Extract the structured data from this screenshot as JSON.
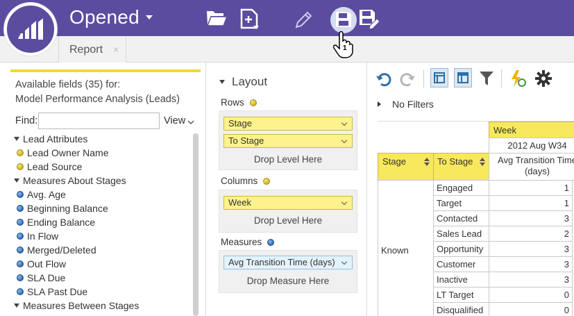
{
  "header": {
    "title": "Opened",
    "badge_count": "1",
    "colors": {
      "bar": "#5c4c9f",
      "accent_yellow": "#f3d730"
    },
    "icons": [
      "marketo-logo-icon",
      "open-folder-icon",
      "new-document-icon",
      "edit-pencil-icon",
      "save-icon",
      "save-as-icon"
    ]
  },
  "tabs": [
    {
      "label": "Report",
      "close": "×"
    }
  ],
  "fields_panel": {
    "available_line1": "Available fields (35) for:",
    "available_line2": "Model Performance Analysis (Leads)",
    "find_label": "Find:",
    "find_value": "",
    "view_label": "View",
    "tree": [
      {
        "type": "group",
        "label": "Lead Attributes"
      },
      {
        "type": "dimension",
        "label": "Lead Owner Name"
      },
      {
        "type": "dimension",
        "label": "Lead Source"
      },
      {
        "type": "group",
        "label": "Measures About Stages"
      },
      {
        "type": "measure",
        "label": "Avg. Age"
      },
      {
        "type": "measure",
        "label": "Beginning Balance"
      },
      {
        "type": "measure",
        "label": "Ending Balance"
      },
      {
        "type": "measure",
        "label": "In Flow"
      },
      {
        "type": "measure",
        "label": "Merged/Deleted"
      },
      {
        "type": "measure",
        "label": "Out Flow"
      },
      {
        "type": "measure",
        "label": "SLA Due"
      },
      {
        "type": "measure",
        "label": "SLA Past Due"
      },
      {
        "type": "group",
        "label": "Measures Between Stages"
      }
    ]
  },
  "layout_panel": {
    "heading": "Layout",
    "rows_label": "Rows",
    "rows": [
      "Stage",
      "To Stage"
    ],
    "rows_drop": "Drop Level Here",
    "columns_label": "Columns",
    "columns": [
      "Week"
    ],
    "columns_drop": "Drop Level Here",
    "measures_label": "Measures",
    "measures": [
      "Avg Transition Time (days)"
    ],
    "measures_drop": "Drop Measure Here"
  },
  "grid_panel": {
    "toolbar_icons": [
      "undo-icon",
      "redo-icon",
      "compact-layout-icon",
      "tabular-layout-icon",
      "filter-icon",
      "refresh-icon",
      "settings-gear-icon"
    ],
    "filters_label": "No Filters",
    "column_header": "Week",
    "week_value": "2012 Aug W34",
    "headers": {
      "stage": "Stage",
      "to_stage": "To Stage",
      "measure": "Avg Transition Time (days)"
    },
    "row_group": "Known",
    "rows": [
      {
        "to_stage": "Engaged",
        "value": "1"
      },
      {
        "to_stage": "Target",
        "value": "1"
      },
      {
        "to_stage": "Contacted",
        "value": "3"
      },
      {
        "to_stage": "Sales Lead",
        "value": "2"
      },
      {
        "to_stage": "Opportunity",
        "value": "3"
      },
      {
        "to_stage": "Customer",
        "value": "3"
      },
      {
        "to_stage": "Inactive",
        "value": "3"
      },
      {
        "to_stage": "LT Target",
        "value": "0"
      },
      {
        "to_stage": "Disqualified",
        "value": "0"
      }
    ]
  }
}
